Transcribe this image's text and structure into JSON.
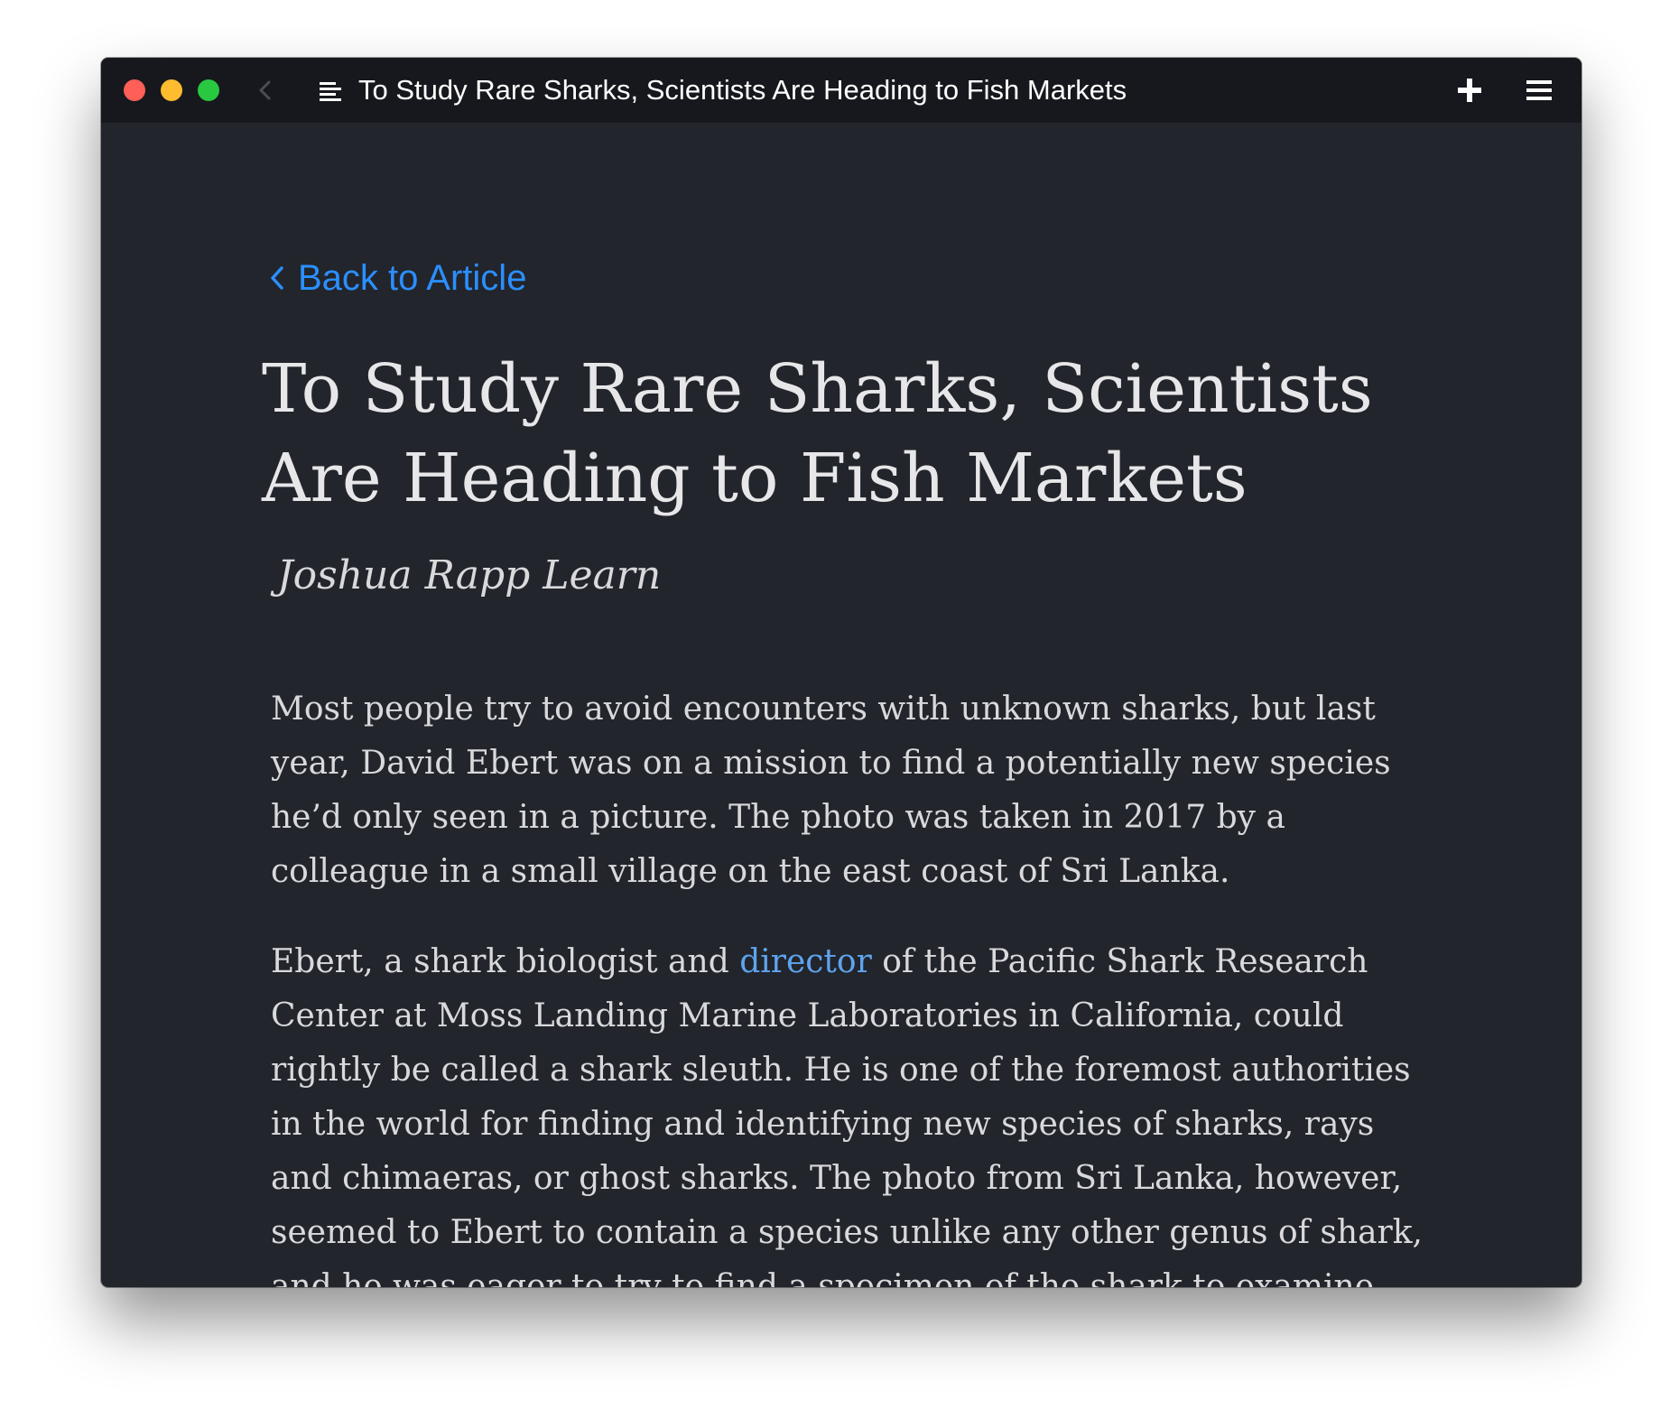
{
  "window": {
    "title": "To Study Rare Sharks, Scientists Are Heading to Fish Markets"
  },
  "toolbar": {
    "back_icon": "chevron-left-icon",
    "reader_icon": "reader-mode-icon",
    "plus_icon": "plus-icon",
    "menu_icon": "hamburger-menu-icon"
  },
  "article": {
    "back_label": "Back to Article",
    "title": "To Study Rare Sharks, Scientists Are Heading to Fish Markets",
    "author": "Joshua Rapp Learn",
    "paragraph1": "Most people try to avoid encounters with unknown sharks, but last year, David Ebert was on a mission to find a potentially new species he’d only seen in a picture. The photo was taken in 2017 by a colleague in a small village on the east coast of Sri Lanka.",
    "paragraph2_before": "Ebert, a shark biologist and ",
    "paragraph2_link": "director",
    "paragraph2_after": " of the Pacific Shark Research Center at Moss Landing Marine Laboratories in California, could rightly be called a shark sleuth. He is one of the foremost authorities in the world for finding and identifying new species of sharks, rays and chimaeras, or ghost sharks. The photo from Sri Lanka, however, seemed to Ebert to contain a species unlike any other genus of shark, and he was eager to try to find a specimen of the shark to examine."
  },
  "colors": {
    "window_bg": "#22252c",
    "titlebar_bg": "#17181d",
    "accent": "#2b8fff",
    "inline_link": "#5ea4ee",
    "text": "#d9d9dc"
  }
}
